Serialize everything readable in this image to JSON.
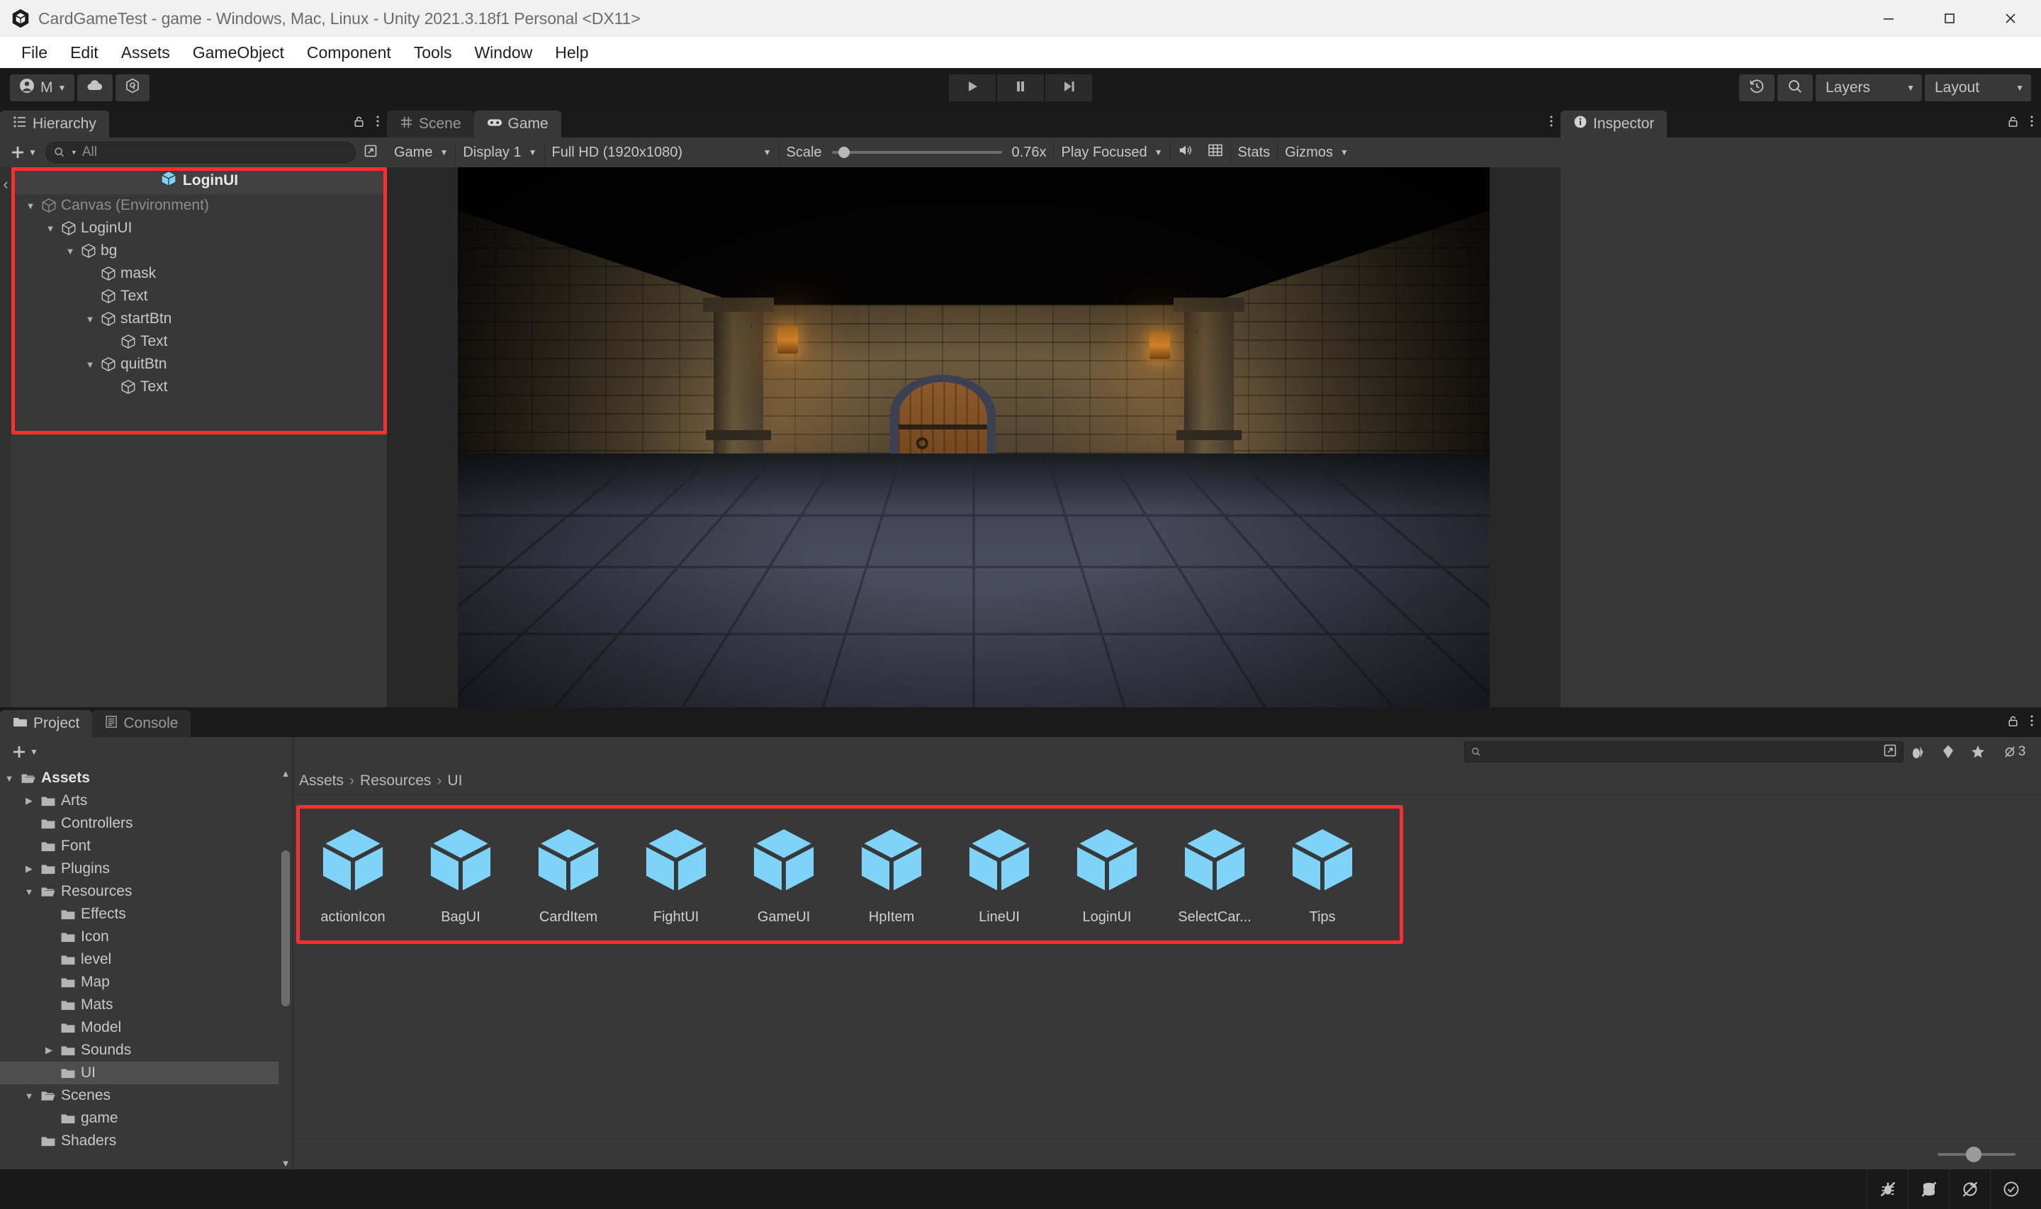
{
  "window": {
    "title": "CardGameTest - game - Windows, Mac, Linux - Unity 2021.3.18f1 Personal <DX11>",
    "logo_icon": "unity-logo-icon",
    "minimize_label": "─",
    "maximize_label": "☐",
    "close_label": "✕"
  },
  "menubar": {
    "items": [
      {
        "label": "File"
      },
      {
        "label": "Edit"
      },
      {
        "label": "Assets"
      },
      {
        "label": "GameObject"
      },
      {
        "label": "Component"
      },
      {
        "label": "Tools"
      },
      {
        "label": "Window"
      },
      {
        "label": "Help"
      }
    ]
  },
  "toolbar": {
    "account_label": "M",
    "account_icon": "account-circle-icon",
    "cloud_icon": "cloud-icon",
    "services_icon": "unity-services-icon",
    "play_icon": "play-icon",
    "pause_icon": "pause-icon",
    "step_icon": "step-forward-icon",
    "undo_history_icon": "undo-history-icon",
    "search_icon": "search-icon",
    "layers_label": "Layers",
    "layout_label": "Layout"
  },
  "hierarchy": {
    "tab_label": "Hierarchy",
    "tab_icon": "hierarchy-icon",
    "lock_icon": "lock-icon",
    "more_icon": "more-vertical-icon",
    "add_label": "+",
    "search_placeholder": "All",
    "search_value": "",
    "search_icon": "search-dropdown-icon",
    "back_arrow": "‹",
    "header_row": {
      "label": "LoginUI",
      "icon": "prefab-cube-icon"
    },
    "items": [
      {
        "label": "Canvas (Environment)",
        "depth": 1,
        "expanded": true,
        "has_children": true,
        "dim": true
      },
      {
        "label": "LoginUI",
        "depth": 2,
        "expanded": true,
        "has_children": true,
        "dim": false
      },
      {
        "label": "bg",
        "depth": 3,
        "expanded": true,
        "has_children": true,
        "dim": false
      },
      {
        "label": "mask",
        "depth": 4,
        "expanded": false,
        "has_children": false,
        "dim": false
      },
      {
        "label": "Text",
        "depth": 4,
        "expanded": false,
        "has_children": false,
        "dim": false
      },
      {
        "label": "startBtn",
        "depth": 4,
        "expanded": true,
        "has_children": true,
        "dim": false
      },
      {
        "label": "Text",
        "depth": 5,
        "expanded": false,
        "has_children": false,
        "dim": false
      },
      {
        "label": "quitBtn",
        "depth": 4,
        "expanded": true,
        "has_children": true,
        "dim": false
      },
      {
        "label": "Text",
        "depth": 5,
        "expanded": false,
        "has_children": false,
        "dim": false
      }
    ],
    "highlight_color": "#ff2e2e"
  },
  "view_tabs": {
    "scene": {
      "label": "Scene",
      "icon": "grid-hash-icon",
      "active": false
    },
    "game": {
      "label": "Game",
      "icon": "gamepad-icon",
      "active": true
    },
    "more_icon": "more-vertical-icon"
  },
  "game_toolbar": {
    "mode_label": "Game",
    "display_label": "Display 1",
    "resolution_label": "Full HD (1920x1080)",
    "scale_label": "Scale",
    "scale_value": "0.76x",
    "scale_percent": 4,
    "play_mode_label": "Play Focused",
    "mute_icon": "speaker-icon",
    "aspect_icon": "frame-grid-icon",
    "stats_label": "Stats",
    "gizmos_label": "Gizmos"
  },
  "inspector": {
    "tab_label": "Inspector",
    "tab_icon": "info-circle-icon",
    "lock_icon": "lock-icon",
    "more_icon": "more-vertical-icon"
  },
  "project": {
    "tabs": [
      {
        "label": "Project",
        "icon": "folder-icon",
        "active": true
      },
      {
        "label": "Console",
        "icon": "console-lines-icon",
        "active": false
      }
    ],
    "lock_icon": "lock-icon",
    "more_icon": "more-vertical-icon",
    "add_label": "+",
    "search_placeholder": "",
    "search_value": "",
    "search_icon": "search-icon",
    "save_search_icon": "save-search-icon",
    "filter_icons": [
      {
        "name": "filter-type-icon",
        "glyph": "♦"
      },
      {
        "name": "filter-label-icon",
        "glyph": "⬟"
      },
      {
        "name": "favorites-star-icon",
        "glyph": "★"
      }
    ],
    "hidden_count_icon": "eye-off-icon",
    "hidden_count": "3",
    "breadcrumb": [
      "Assets",
      "Resources",
      "UI"
    ],
    "tree": [
      {
        "label": "Assets",
        "depth": 0,
        "expanded": true,
        "arrow": "down",
        "open_folder": true,
        "bold": true,
        "selected": false
      },
      {
        "label": "Arts",
        "depth": 1,
        "expanded": false,
        "arrow": "right",
        "open_folder": false,
        "bold": false,
        "selected": false
      },
      {
        "label": "Controllers",
        "depth": 1,
        "expanded": false,
        "arrow": "none",
        "open_folder": false,
        "bold": false,
        "selected": false
      },
      {
        "label": "Font",
        "depth": 1,
        "expanded": false,
        "arrow": "none",
        "open_folder": false,
        "bold": false,
        "selected": false
      },
      {
        "label": "Plugins",
        "depth": 1,
        "expanded": false,
        "arrow": "right",
        "open_folder": false,
        "bold": false,
        "selected": false
      },
      {
        "label": "Resources",
        "depth": 1,
        "expanded": true,
        "arrow": "down",
        "open_folder": true,
        "bold": false,
        "selected": false
      },
      {
        "label": "Effects",
        "depth": 2,
        "expanded": false,
        "arrow": "none",
        "open_folder": false,
        "bold": false,
        "selected": false
      },
      {
        "label": "Icon",
        "depth": 2,
        "expanded": false,
        "arrow": "none",
        "open_folder": false,
        "bold": false,
        "selected": false
      },
      {
        "label": "level",
        "depth": 2,
        "expanded": false,
        "arrow": "none",
        "open_folder": false,
        "bold": false,
        "selected": false
      },
      {
        "label": "Map",
        "depth": 2,
        "expanded": false,
        "arrow": "none",
        "open_folder": false,
        "bold": false,
        "selected": false
      },
      {
        "label": "Mats",
        "depth": 2,
        "expanded": false,
        "arrow": "none",
        "open_folder": false,
        "bold": false,
        "selected": false
      },
      {
        "label": "Model",
        "depth": 2,
        "expanded": false,
        "arrow": "none",
        "open_folder": false,
        "bold": false,
        "selected": false
      },
      {
        "label": "Sounds",
        "depth": 2,
        "expanded": false,
        "arrow": "right",
        "open_folder": false,
        "bold": false,
        "selected": false
      },
      {
        "label": "UI",
        "depth": 2,
        "expanded": false,
        "arrow": "none",
        "open_folder": false,
        "bold": false,
        "selected": true
      },
      {
        "label": "Scenes",
        "depth": 1,
        "expanded": true,
        "arrow": "down",
        "open_folder": true,
        "bold": false,
        "selected": false
      },
      {
        "label": "game",
        "depth": 2,
        "expanded": false,
        "arrow": "none",
        "open_folder": false,
        "bold": false,
        "selected": false
      },
      {
        "label": "Shaders",
        "depth": 1,
        "expanded": false,
        "arrow": "none",
        "open_folder": false,
        "bold": false,
        "selected": false
      }
    ],
    "assets": [
      {
        "label": "actionIcon",
        "icon": "prefab-cube-icon"
      },
      {
        "label": "BagUI",
        "icon": "prefab-cube-icon"
      },
      {
        "label": "CardItem",
        "icon": "prefab-cube-icon"
      },
      {
        "label": "FightUI",
        "icon": "prefab-cube-icon"
      },
      {
        "label": "GameUI",
        "icon": "prefab-cube-icon"
      },
      {
        "label": "HpItem",
        "icon": "prefab-cube-icon"
      },
      {
        "label": "LineUI",
        "icon": "prefab-cube-icon"
      },
      {
        "label": "LoginUI",
        "icon": "prefab-cube-icon"
      },
      {
        "label": "SelectCar...",
        "icon": "prefab-cube-icon"
      },
      {
        "label": "Tips",
        "icon": "prefab-cube-icon"
      }
    ],
    "zoom_value": 40,
    "highlight_color": "#ff2e2e"
  },
  "statusbar": {
    "buttons": [
      {
        "name": "debug-bug-off-icon",
        "glyph": "bug"
      },
      {
        "name": "database-off-icon",
        "glyph": "db"
      },
      {
        "name": "collab-off-icon",
        "glyph": "collab"
      },
      {
        "name": "check-circle-icon",
        "glyph": "check"
      }
    ]
  },
  "colors": {
    "accent_blue": "#7fd3f7",
    "panel_bg": "#383838",
    "dark_bg": "#1a1a1a",
    "highlight_red": "#ff2e2e"
  }
}
